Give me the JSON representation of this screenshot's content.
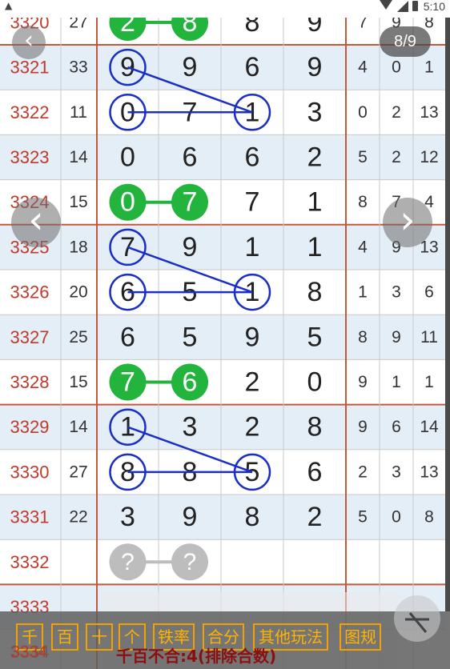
{
  "status_bar": {
    "time": "5:10"
  },
  "image_counter": "8/9",
  "nav": {
    "prev_label": "‹",
    "next_label": "›",
    "back_label": "‹"
  },
  "colors": {
    "issue_text": "#c0392b",
    "row_even": "#ffffff",
    "row_odd": "#e4eef7",
    "grid_line": "#c9c9c9",
    "block_line": "#c4583a",
    "digit": "#222222",
    "green": "#22b43c",
    "blue_ring": "#1c2fc4",
    "grey_unknown": "#bdbdbd",
    "button_orange": "#f2a100"
  },
  "rows": [
    {
      "issue": "3320",
      "sum": "27",
      "digits": [
        "2",
        "8",
        "8",
        "9"
      ],
      "stats": [
        "7",
        "9",
        "8"
      ]
    },
    {
      "issue": "3321",
      "sum": "33",
      "digits": [
        "9",
        "9",
        "6",
        "9"
      ],
      "stats": [
        "4",
        "0",
        "1"
      ]
    },
    {
      "issue": "3322",
      "sum": "11",
      "digits": [
        "0",
        "7",
        "1",
        "3"
      ],
      "stats": [
        "0",
        "2",
        "13"
      ]
    },
    {
      "issue": "3323",
      "sum": "14",
      "digits": [
        "0",
        "6",
        "6",
        "2"
      ],
      "stats": [
        "5",
        "2",
        "12"
      ]
    },
    {
      "issue": "3324",
      "sum": "15",
      "digits": [
        "0",
        "7",
        "7",
        "1"
      ],
      "stats": [
        "8",
        "7",
        "4"
      ]
    },
    {
      "issue": "3325",
      "sum": "18",
      "digits": [
        "7",
        "9",
        "1",
        "1"
      ],
      "stats": [
        "4",
        "9",
        "13"
      ]
    },
    {
      "issue": "3326",
      "sum": "20",
      "digits": [
        "6",
        "5",
        "1",
        "8"
      ],
      "stats": [
        "1",
        "3",
        "6"
      ]
    },
    {
      "issue": "3327",
      "sum": "25",
      "digits": [
        "6",
        "5",
        "9",
        "5"
      ],
      "stats": [
        "8",
        "9",
        "11"
      ]
    },
    {
      "issue": "3328",
      "sum": "15",
      "digits": [
        "7",
        "6",
        "2",
        "0"
      ],
      "stats": [
        "9",
        "1",
        "1"
      ]
    },
    {
      "issue": "3329",
      "sum": "14",
      "digits": [
        "1",
        "3",
        "2",
        "8"
      ],
      "stats": [
        "9",
        "6",
        "14"
      ]
    },
    {
      "issue": "3330",
      "sum": "27",
      "digits": [
        "8",
        "8",
        "5",
        "6"
      ],
      "stats": [
        "2",
        "3",
        "13"
      ]
    },
    {
      "issue": "3331",
      "sum": "22",
      "digits": [
        "3",
        "9",
        "8",
        "2"
      ],
      "stats": [
        "5",
        "0",
        "8"
      ]
    },
    {
      "issue": "3332",
      "sum": "",
      "digits": [
        "?",
        "?",
        "",
        ""
      ],
      "stats": [
        "",
        "",
        ""
      ]
    },
    {
      "issue": "3333",
      "sum": "",
      "digits": [
        "",
        "",
        "",
        ""
      ],
      "stats": [
        "",
        "",
        ""
      ]
    },
    {
      "issue": "3334",
      "sum": "",
      "digits": [
        "",
        "",
        "",
        ""
      ],
      "stats": [
        "",
        "",
        ""
      ]
    }
  ],
  "green_pairs": [
    0,
    4,
    8
  ],
  "grey_pairs": [
    12
  ],
  "blue_groups": [
    {
      "rows": [
        1,
        2
      ],
      "circles": [
        [
          1,
          0
        ],
        [
          2,
          0
        ],
        [
          2,
          2
        ]
      ],
      "links": [
        [
          [
            1,
            0
          ],
          [
            2,
            2
          ]
        ],
        [
          [
            2,
            0
          ],
          [
            2,
            2
          ]
        ]
      ]
    },
    {
      "rows": [
        5,
        6
      ],
      "circles": [
        [
          5,
          0
        ],
        [
          6,
          0
        ],
        [
          6,
          2
        ]
      ],
      "links": [
        [
          [
            5,
            0
          ],
          [
            6,
            2
          ]
        ],
        [
          [
            6,
            0
          ],
          [
            6,
            2
          ]
        ]
      ]
    },
    {
      "rows": [
        9,
        10
      ],
      "circles": [
        [
          9,
          0
        ],
        [
          10,
          0
        ],
        [
          10,
          2
        ]
      ],
      "links": [
        [
          [
            9,
            0
          ],
          [
            10,
            2
          ]
        ],
        [
          [
            10,
            0
          ],
          [
            10,
            2
          ]
        ]
      ]
    }
  ],
  "bottom_buttons": [
    "千",
    "百",
    "十",
    "个",
    "铁率",
    "合分",
    "其他玩法",
    "图规"
  ],
  "peek_title": "千百不合:4(排除合数)"
}
